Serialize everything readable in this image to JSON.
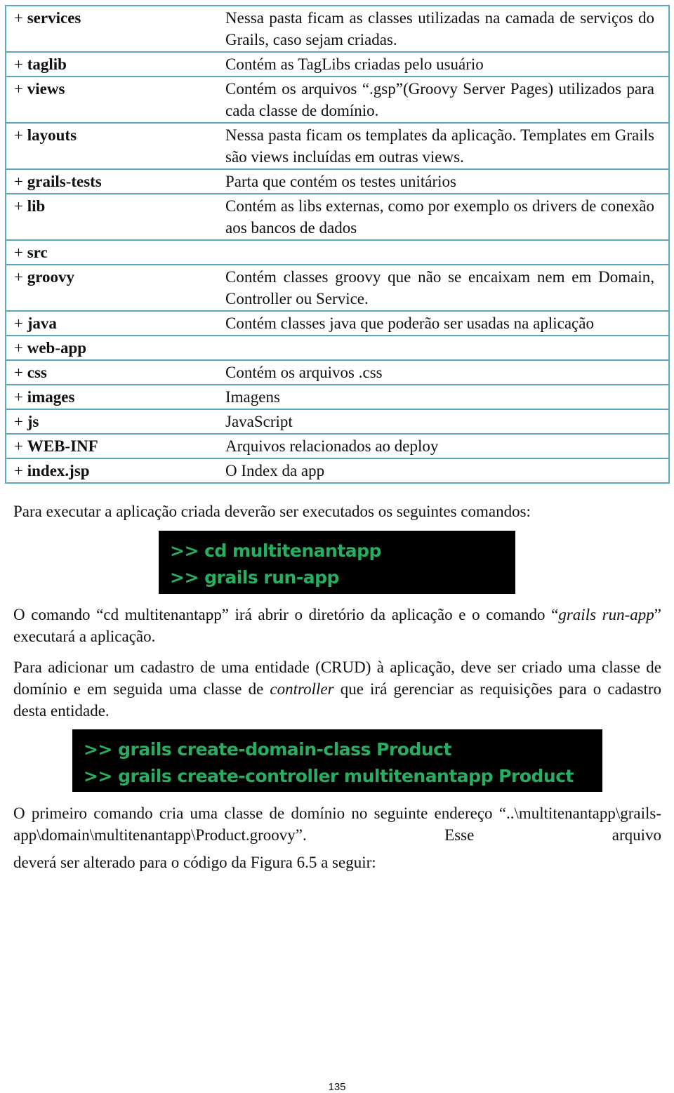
{
  "directory_table": {
    "rows": [
      {
        "name": "services",
        "description": "Nessa pasta ficam as classes utilizadas na camada de serviços do Grails, caso sejam criadas."
      },
      {
        "name": "taglib",
        "description": "Contém as TagLibs criadas pelo usuário"
      },
      {
        "name": "views",
        "description": "Contém os arquivos “.gsp”(Groovy Server Pages) utilizados para cada classe de domínio."
      },
      {
        "name": "layouts",
        "description": "Nessa pasta ficam os templates da aplicação. Templates em Grails são views incluídas em outras views."
      },
      {
        "name": "grails-tests",
        "description": "Parta que contém os testes unitários"
      },
      {
        "name": "lib",
        "description": "Contém  as libs externas, como por exemplo os drivers de conexão aos bancos de dados"
      },
      {
        "name": "src",
        "description": ""
      },
      {
        "name": "groovy",
        "description": "Contém classes groovy que não se encaixam nem em Domain, Controller ou Service."
      },
      {
        "name": "java",
        "description": "Contém classes java que poderão ser usadas na aplicação"
      },
      {
        "name": "web-app",
        "description": ""
      },
      {
        "name": "css",
        "description": "Contém os arquivos .css"
      },
      {
        "name": "images",
        "description": "Imagens"
      },
      {
        "name": "js",
        "description": "JavaScript"
      },
      {
        "name": "WEB-INF",
        "description": "Arquivos relacionados ao deploy"
      },
      {
        "name": "index.jsp",
        "description": "O Index da app"
      }
    ],
    "prefix": "+ "
  },
  "paragraphs": {
    "run_intro": "Para executar a aplicação criada deverão ser executados os seguintes comandos:",
    "run_explain_1": "O comando “cd multitenantapp” irá abrir o diretório da aplicação e o comando “",
    "run_explain_italic": "grails run-app",
    "run_explain_2": "” executará a aplicação.",
    "crud_1": "Para adicionar um cadastro de uma entidade (CRUD) à aplicação, deve ser criado uma classe de domínio e em seguida uma classe de ",
    "crud_italic": "controller",
    "crud_2": " que irá gerenciar as requisições para o cadastro desta entidade.",
    "first_cmd": "O primeiro comando cria uma classe de domínio no seguinte endereço “..\\multitenantapp\\grails-app\\domain\\multitenantapp\\Product.groovy”.  Esse arquivo",
    "first_cmd_last": "deverá ser alterado para o código da Figura 6.5 a seguir:"
  },
  "code_blocks": {
    "run": [
      ">> cd multitenantapp",
      ">> grails run-app"
    ],
    "create": [
      ">> grails create-domain-class Product",
      ">> grails create-controller multitenantapp Product"
    ]
  },
  "colors": {
    "table_border": "#5aa7c0",
    "code_bg": "#000000",
    "code_text": "#27ae60"
  },
  "footer": {
    "page_number": "135"
  }
}
